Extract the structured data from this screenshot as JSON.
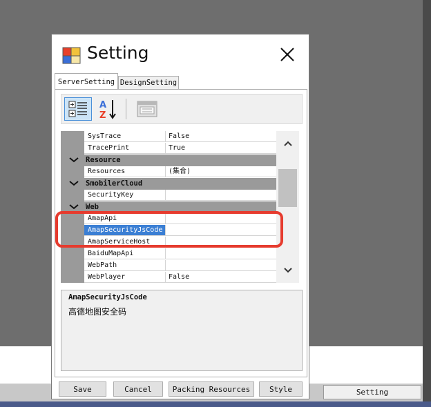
{
  "dialog": {
    "title": "Setting",
    "tabs": [
      {
        "label": "ServerSetting",
        "active": true
      },
      {
        "label": "DesignSetting",
        "active": false
      }
    ]
  },
  "toolbar": {
    "categorized_icon": "categorized-view-icon",
    "alphabetical_icon": "sort-alphabetical-icon",
    "property_pages_icon": "property-pages-icon"
  },
  "grid": {
    "rows": [
      {
        "type": "property",
        "name": "SysTrace",
        "value": "False"
      },
      {
        "type": "property",
        "name": "TracePrint",
        "value": "True"
      },
      {
        "type": "category",
        "name": "Resource"
      },
      {
        "type": "property",
        "name": "Resources",
        "value": "(集合)"
      },
      {
        "type": "category",
        "name": "SmobilerCloud"
      },
      {
        "type": "property",
        "name": "SecurityKey",
        "value": ""
      },
      {
        "type": "category",
        "name": "Web"
      },
      {
        "type": "property",
        "name": "AmapApi",
        "value": ""
      },
      {
        "type": "property",
        "name": "AmapSecurityJsCode",
        "value": "",
        "selected": true
      },
      {
        "type": "property",
        "name": "AmapServiceHost",
        "value": ""
      },
      {
        "type": "property",
        "name": "BaiduMapApi",
        "value": ""
      },
      {
        "type": "property",
        "name": "WebPath",
        "value": ""
      },
      {
        "type": "property",
        "name": "WebPlayer",
        "value": "False"
      }
    ]
  },
  "description": {
    "title": "AmapSecurityJsCode",
    "text": "高德地图安全码"
  },
  "buttons": {
    "save": "Save",
    "cancel": "Cancel",
    "packing": "Packing Resources",
    "style": "Style"
  },
  "taskbar": {
    "setting": "Setting"
  },
  "colors": {
    "selection": "#3b7fd4",
    "highlight": "#e63b2e",
    "category_bg": "#9a9a9a"
  }
}
